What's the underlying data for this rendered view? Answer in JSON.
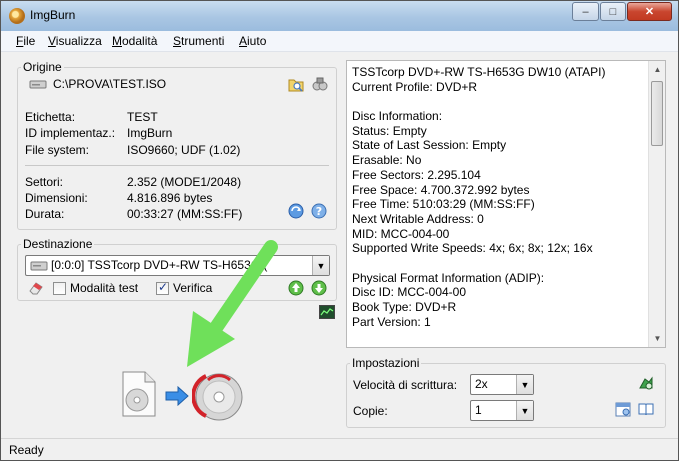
{
  "window": {
    "title": "ImgBurn",
    "controls": {
      "minimize": "–",
      "maximize": "□",
      "close": "✕"
    }
  },
  "menu": [
    "File",
    "Visualizza",
    "Modalità",
    "Strumenti",
    "Aiuto"
  ],
  "source": {
    "title": "Origine",
    "path": "C:\\PROVA\\TEST.ISO",
    "fields": [
      {
        "label": "Etichetta:",
        "value": "TEST"
      },
      {
        "label": "ID implementaz.:",
        "value": "ImgBurn"
      },
      {
        "label": "File system:",
        "value": "ISO9660; UDF (1.02)"
      }
    ],
    "sizes": [
      {
        "label": "Settori:",
        "value": "2.352 (MODE1/2048)"
      },
      {
        "label": "Dimensioni:",
        "value": "4.816.896 bytes"
      },
      {
        "label": "Durata:",
        "value": "00:33:27 (MM:SS:FF)"
      }
    ]
  },
  "destination": {
    "title": "Destinazione",
    "drive": "[0:0:0] TSSTcorp DVD+-RW TS-H653G (",
    "test_mode": {
      "label": "Modalità test",
      "checked": false
    },
    "verify": {
      "label": "Verifica",
      "checked": true
    }
  },
  "info": {
    "lines": [
      "TSSTcorp DVD+-RW TS-H653G DW10 (ATAPI)",
      "Current Profile: DVD+R",
      "",
      "Disc Information:",
      "Status: Empty",
      "State of Last Session: Empty",
      "Erasable: No",
      "Free Sectors: 2.295.104",
      "Free Space: 4.700.372.992 bytes",
      "Free Time: 510:03:29 (MM:SS:FF)",
      "Next Writable Address: 0",
      "MID: MCC-004-00",
      "Supported Write Speeds: 4x; 6x; 8x; 12x; 16x",
      "",
      "Physical Format Information (ADIP):",
      "Disc ID: MCC-004-00",
      "Book Type: DVD+R",
      "Part Version: 1"
    ]
  },
  "settings": {
    "title": "Impostazioni",
    "write_speed": {
      "label": "Velocità di scrittura:",
      "value": "2x"
    },
    "copies": {
      "label": "Copie:",
      "value": "1"
    }
  },
  "status": "Ready",
  "colors": {
    "arrow_green": "#6fe05a",
    "accent_blue": "#3a8ee6",
    "burn_red": "#d2232a"
  }
}
